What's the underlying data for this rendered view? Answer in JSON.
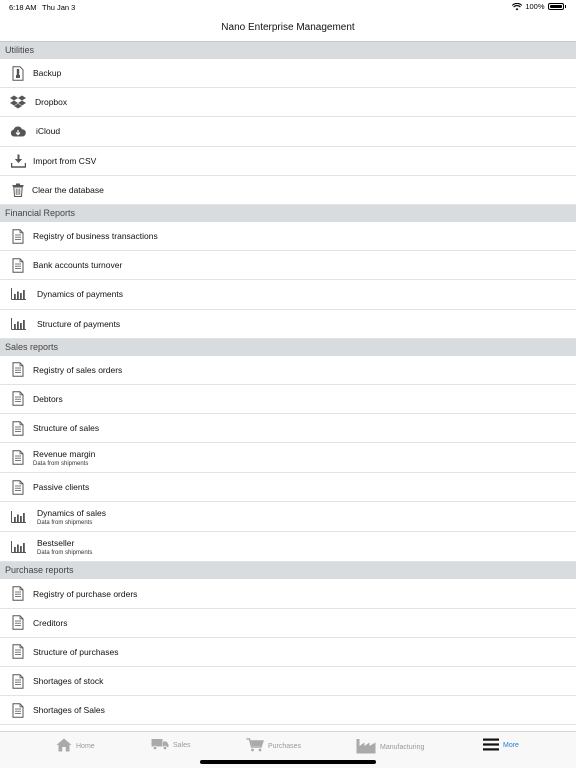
{
  "status": {
    "time": "6:18 AM",
    "date": "Thu Jan 3",
    "battery": "100%"
  },
  "nav": {
    "title": "Nano Enterprise Management"
  },
  "sections": [
    {
      "header": "Utilities",
      "items": [
        {
          "label": "Backup",
          "icon": "backup-icon"
        },
        {
          "label": "Dropbox",
          "icon": "dropbox-icon"
        },
        {
          "label": "iCloud",
          "icon": "icloud-icon"
        },
        {
          "label": "Import from CSV",
          "icon": "download-icon"
        },
        {
          "label": "Clear the database",
          "icon": "trash-icon"
        }
      ]
    },
    {
      "header": "Financial Reports",
      "items": [
        {
          "label": "Registry of business transactions",
          "icon": "document-icon"
        },
        {
          "label": "Bank accounts turnover",
          "icon": "document-icon"
        },
        {
          "label": "Dynamics of payments",
          "icon": "bar-chart-icon"
        },
        {
          "label": "Structure of payments",
          "icon": "bar-chart-icon"
        }
      ]
    },
    {
      "header": "Sales reports",
      "items": [
        {
          "label": "Registry of sales orders",
          "icon": "document-icon"
        },
        {
          "label": "Debtors",
          "icon": "document-icon"
        },
        {
          "label": "Structure of sales",
          "icon": "document-icon"
        },
        {
          "label": "Revenue margin",
          "sub": "Data from shipments",
          "icon": "document-icon"
        },
        {
          "label": "Passive clients",
          "icon": "document-icon"
        },
        {
          "label": "Dynamics of sales",
          "sub": "Data from shipments",
          "icon": "bar-chart-icon"
        },
        {
          "label": "Bestseller",
          "sub": "Data from shipments",
          "icon": "bar-chart-icon"
        }
      ]
    },
    {
      "header": "Purchase reports",
      "items": [
        {
          "label": "Registry of purchase orders",
          "icon": "document-icon"
        },
        {
          "label": "Creditors",
          "icon": "document-icon"
        },
        {
          "label": "Structure of purchases",
          "icon": "document-icon"
        },
        {
          "label": "Shortages of stock",
          "icon": "document-icon"
        },
        {
          "label": "Shortages of Sales",
          "icon": "document-icon"
        }
      ]
    }
  ],
  "tabs": [
    {
      "label": "Home",
      "icon": "home-icon",
      "active": false
    },
    {
      "label": "Sales",
      "icon": "truck-icon",
      "active": false
    },
    {
      "label": "Purchases",
      "icon": "cart-icon",
      "active": false
    },
    {
      "label": "Manufacturing",
      "icon": "factory-icon",
      "active": false
    },
    {
      "label": "More",
      "icon": "menu-icon",
      "active": true
    }
  ],
  "colors": {
    "accent": "#2a7cd6",
    "section_bg": "#d8dcdf",
    "icon": "#555555"
  }
}
